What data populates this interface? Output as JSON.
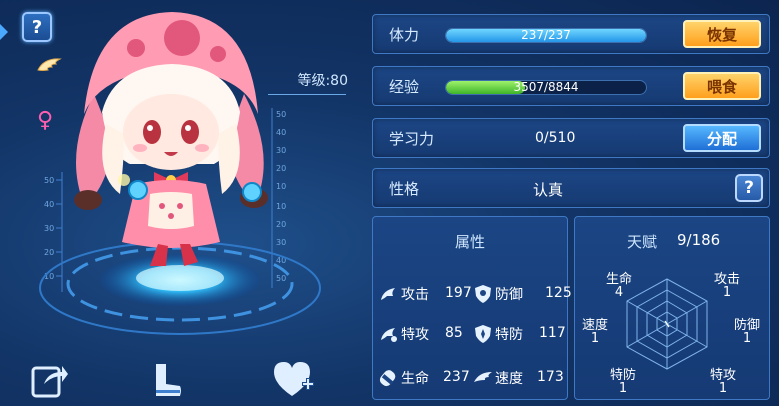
{
  "left": {
    "help_label": "?",
    "level_text": "等级:80",
    "ruler_left": [
      "50",
      "40",
      "30",
      "20",
      "10"
    ],
    "ruler_right": [
      "50",
      "40",
      "30",
      "20",
      "10",
      "10",
      "20",
      "30",
      "40",
      "50"
    ]
  },
  "stats": {
    "stamina_label": "体力",
    "stamina_text": "237/237",
    "stamina_fraction": 1.0,
    "restore_button": "恢复",
    "exp_label": "经验",
    "exp_text": "3507/8844",
    "exp_fraction": 0.3965,
    "feed_button": "喂食",
    "learn_label": "学习力",
    "learn_value": "0/510",
    "allocate_button": "分配",
    "nature_label": "性格",
    "nature_value": "认真",
    "nature_help": "?"
  },
  "attributes": {
    "title": "属性",
    "items": [
      {
        "name": "攻击",
        "value": "197"
      },
      {
        "name": "防御",
        "value": "125"
      },
      {
        "name": "特攻",
        "value": "85"
      },
      {
        "name": "特防",
        "value": "117"
      },
      {
        "name": "生命",
        "value": "237"
      },
      {
        "name": "速度",
        "value": "173"
      }
    ]
  },
  "talent": {
    "title": "天赋",
    "count": "9/186",
    "axes": [
      {
        "name": "生命",
        "value": "4"
      },
      {
        "name": "攻击",
        "value": "1"
      },
      {
        "name": "防御",
        "value": "1"
      },
      {
        "name": "特攻",
        "value": "1"
      },
      {
        "name": "特防",
        "value": "1"
      },
      {
        "name": "速度",
        "value": "1"
      }
    ]
  },
  "colors": {
    "accent_orange": "#ff9f1c",
    "accent_blue": "#1f6fd6",
    "hp_bar": "#2596e8",
    "exp_bar": "#3fb52a",
    "female": "#ff5fb0"
  }
}
